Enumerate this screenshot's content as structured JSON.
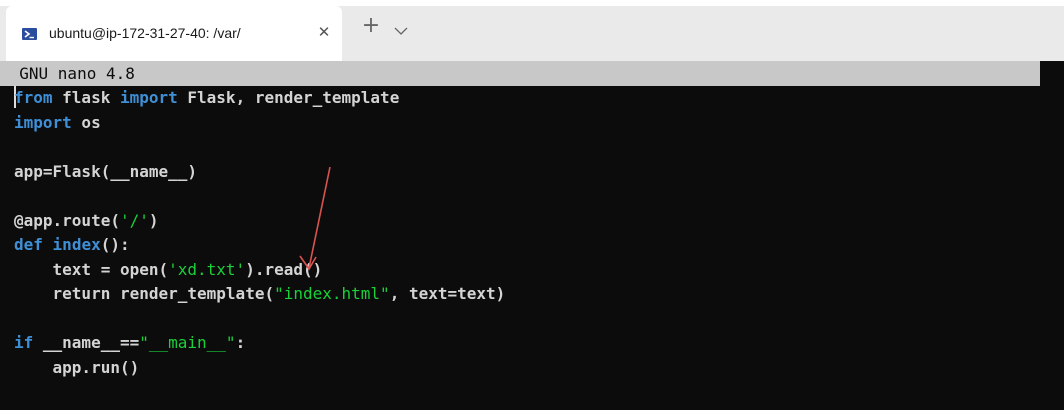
{
  "tab": {
    "title": "ubuntu@ip-172-31-27-40: /var/",
    "close_glyph": "✕",
    "new_tab_glyph": "+"
  },
  "editor": {
    "header": "  GNU nano 4.8",
    "lines": {
      "l1": [
        "from",
        " flask ",
        "import",
        " Flask, render_template"
      ],
      "l2": [
        "import",
        " os"
      ],
      "l4": "app=Flask(__name__)",
      "l6": [
        "@app.route(",
        "'/'",
        ")"
      ],
      "l7": [
        "def",
        " ",
        "index",
        "():"
      ],
      "l8": [
        "    text = open(",
        "'xd.txt'",
        ").read()"
      ],
      "l9": [
        "    return render_template(",
        "\"index.html\"",
        ", text=text)"
      ],
      "l11": [
        "if",
        " __name__==",
        "\"__main__\"",
        ":"
      ],
      "l12": "    app.run()"
    }
  },
  "colors": {
    "keyword": "#3f8fd6",
    "string": "#1ad13a",
    "text": "#d4d4d4",
    "annotation_arrow": "#d9534f"
  }
}
